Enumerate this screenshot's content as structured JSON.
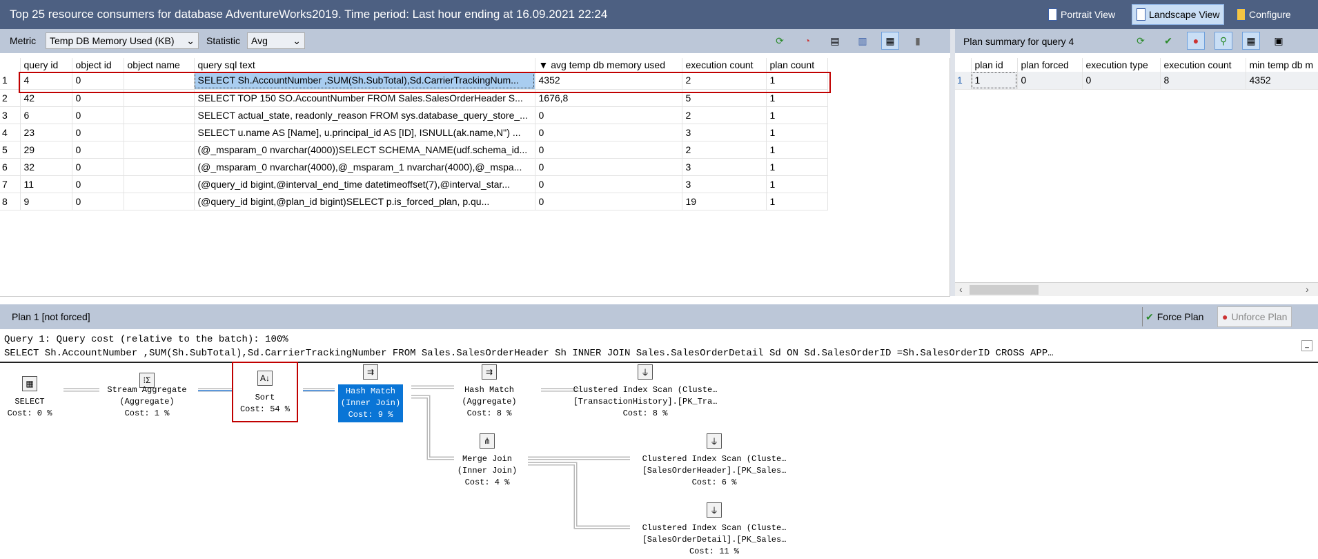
{
  "title": "Top 25 resource consumers for database AdventureWorks2019. Time period: Last hour ending at 16.09.2021 22:24",
  "views": {
    "portrait": "Portrait View",
    "landscape": "Landscape View",
    "configure": "Configure"
  },
  "toolbar": {
    "metric_label": "Metric",
    "metric_value": "Temp DB Memory Used (KB)",
    "statistic_label": "Statistic",
    "statistic_value": "Avg"
  },
  "main_table": {
    "columns": [
      "query id",
      "object id",
      "object name",
      "query sql text",
      "▼ avg temp db memory used",
      "execution count",
      "plan count"
    ],
    "rows": [
      [
        "1",
        "4",
        "0",
        "",
        "SELECT   Sh.AccountNumber ,SUM(Sh.SubTotal),Sd.CarrierTrackingNum...",
        "4352",
        "2",
        "1"
      ],
      [
        "2",
        "42",
        "0",
        "",
        "SELECT  TOP 150 SO.AccountNumber FROM  Sales.SalesOrderHeader S...",
        "1676,8",
        "5",
        "1"
      ],
      [
        "3",
        "6",
        "0",
        "",
        "SELECT actual_state, readonly_reason FROM sys.database_query_store_...",
        "0",
        "2",
        "1"
      ],
      [
        "4",
        "23",
        "0",
        "",
        "SELECT u.name AS [Name], u.principal_id AS [ID], ISNULL(ak.name,N'') ...",
        "0",
        "3",
        "1"
      ],
      [
        "5",
        "29",
        "0",
        "",
        "(@_msparam_0 nvarchar(4000))SELECT SCHEMA_NAME(udf.schema_id...",
        "0",
        "2",
        "1"
      ],
      [
        "6",
        "32",
        "0",
        "",
        "(@_msparam_0 nvarchar(4000),@_msparam_1 nvarchar(4000),@_mspa...",
        "0",
        "3",
        "1"
      ],
      [
        "7",
        "11",
        "0",
        "",
        "(@query_id bigint,@interval_end_time datetimeoffset(7),@interval_star...",
        "0",
        "3",
        "1"
      ],
      [
        "8",
        "9",
        "0",
        "",
        "(@query_id bigint,@plan_id bigint)SELECT      p.is_forced_plan,      p.qu...",
        "0",
        "19",
        "1"
      ]
    ]
  },
  "plan_summary": {
    "title": "Plan summary for query 4",
    "columns": [
      "plan id",
      "plan forced",
      "execution type",
      "execution count",
      "min temp db m"
    ],
    "rows": [
      [
        "1",
        "1",
        "0",
        "0",
        "8",
        "4352"
      ]
    ]
  },
  "plan_bar": {
    "title": "Plan 1 [not forced]",
    "force": "Force Plan",
    "unforce": "Unforce Plan"
  },
  "query_header": {
    "line1": "Query 1: Query cost (relative to the batch): 100%",
    "line2": "SELECT Sh.AccountNumber ,SUM(Sh.SubTotal),Sd.CarrierTrackingNumber FROM Sales.SalesOrderHeader Sh INNER JOIN Sales.SalesOrderDetail Sd ON Sd.SalesOrderID =Sh.SalesOrderID CROSS APP…"
  },
  "plan_nodes": [
    {
      "lines": [
        "SELECT",
        "Cost: 0 %"
      ]
    },
    {
      "lines": [
        "Stream Aggregate",
        "(Aggregate)",
        "Cost: 1 %"
      ]
    },
    {
      "lines": [
        "Sort",
        "Cost: 54 %"
      ]
    },
    {
      "lines": [
        "Hash Match",
        "(Inner Join)",
        "Cost: 9 %"
      ]
    },
    {
      "lines": [
        "Hash Match",
        "(Aggregate)",
        "Cost: 8 %"
      ]
    },
    {
      "lines": [
        "Clustered Index Scan (Cluste…",
        "[TransactionHistory].[PK_Tra…",
        "Cost: 8 %"
      ]
    },
    {
      "lines": [
        "Merge Join",
        "(Inner Join)",
        "Cost: 4 %"
      ]
    },
    {
      "lines": [
        "Clustered Index Scan (Cluste…",
        "[SalesOrderHeader].[PK_Sales…",
        "Cost: 6 %"
      ]
    },
    {
      "lines": [
        "Clustered Index Scan (Cluste…",
        "[SalesOrderDetail].[PK_Sales…",
        "Cost: 11 %"
      ]
    }
  ],
  "colors": {
    "title_bg": "#4d6082",
    "toolbar_bg": "#bcc7d8",
    "selection": "#a9cdf0",
    "plan_selected": "#0a75d6",
    "highlight": "#c00000"
  }
}
